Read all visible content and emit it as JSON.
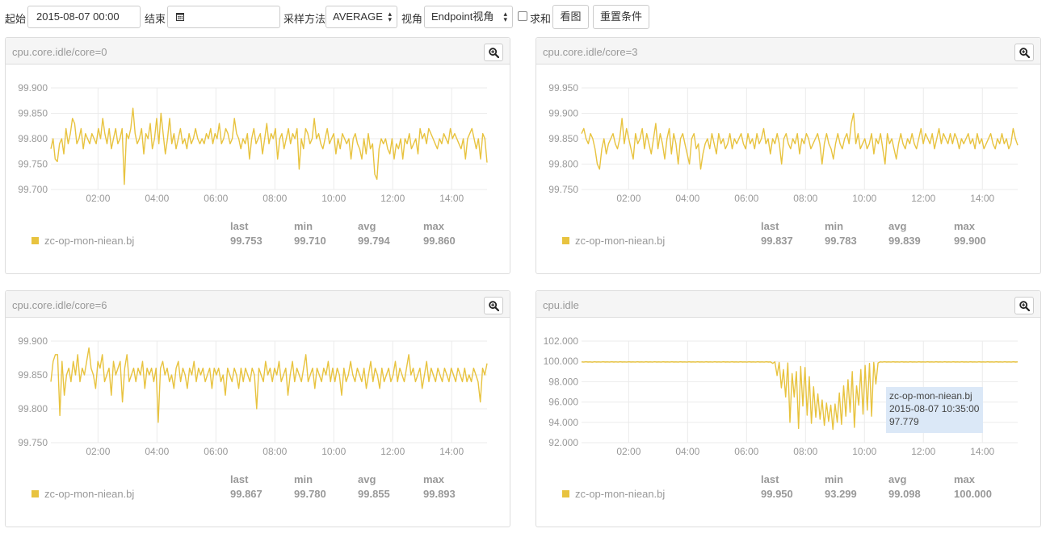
{
  "toolbar": {
    "start_label": "起始",
    "start_value": "2015-08-07 00:00",
    "end_label": "结束",
    "end_value": "",
    "sampling_label": "采样方法",
    "sampling_value": "AVERAGE",
    "view_label": "视角",
    "view_value": "Endpoint视角",
    "sum_label": "求和",
    "sum_checked": false,
    "view_button": "看图",
    "reset_button": "重置条件"
  },
  "stats_headers": [
    "last",
    "min",
    "avg",
    "max"
  ],
  "series_color": "#e8c33f",
  "tooltip": {
    "chart_index": 3,
    "line1": "zc-op-mon-niean.bj",
    "line2": "2015-08-07 10:35:00",
    "line3": "97.779",
    "x_hour": 10.583
  },
  "chart_data": [
    {
      "type": "line",
      "title": "cpu.core.idle/core=0",
      "xlim": [
        0.4,
        15.2
      ],
      "ylim": [
        99.7,
        99.9
      ],
      "yticks": [
        "99.700",
        "99.750",
        "99.800",
        "99.850",
        "99.900"
      ],
      "xticks": [
        "02:00",
        "04:00",
        "06:00",
        "08:00",
        "10:00",
        "12:00",
        "14:00"
      ],
      "grid": true,
      "series": [
        {
          "name": "zc-op-mon-niean.bj",
          "x_start": 0.4,
          "x_end": 15.2,
          "y": [
            99.78,
            99.8,
            99.76,
            99.755,
            99.79,
            99.8,
            99.77,
            99.82,
            99.79,
            99.81,
            99.84,
            99.83,
            99.79,
            99.8,
            99.82,
            99.78,
            99.81,
            99.8,
            99.79,
            99.81,
            99.8,
            99.79,
            99.82,
            99.8,
            99.84,
            99.81,
            99.79,
            99.82,
            99.78,
            99.8,
            99.82,
            99.79,
            99.8,
            99.82,
            99.71,
            99.81,
            99.8,
            99.82,
            99.86,
            99.81,
            99.79,
            99.8,
            99.82,
            99.77,
            99.81,
            99.8,
            99.83,
            99.78,
            99.8,
            99.84,
            99.79,
            99.85,
            99.81,
            99.77,
            99.8,
            99.84,
            99.79,
            99.81,
            99.78,
            99.8,
            99.82,
            99.79,
            99.8,
            99.78,
            99.81,
            99.79,
            99.8,
            99.82,
            99.8,
            99.79,
            99.8,
            99.79,
            99.81,
            99.8,
            99.82,
            99.79,
            99.81,
            99.8,
            99.83,
            99.79,
            99.8,
            99.82,
            99.81,
            99.79,
            99.8,
            99.84,
            99.81,
            99.8,
            99.78,
            99.8,
            99.79,
            99.81,
            99.76,
            99.8,
            99.82,
            99.79,
            99.8,
            99.81,
            99.77,
            99.8,
            99.83,
            99.79,
            99.81,
            99.8,
            99.82,
            99.76,
            99.8,
            99.81,
            99.78,
            99.8,
            99.82,
            99.79,
            99.81,
            99.8,
            99.82,
            99.74,
            99.8,
            99.78,
            99.82,
            99.81,
            99.79,
            99.8,
            99.84,
            99.8,
            99.81,
            99.79,
            99.78,
            99.8,
            99.82,
            99.79,
            99.8,
            99.81,
            99.77,
            99.8,
            99.78,
            99.81,
            99.8,
            99.79,
            99.8,
            99.76,
            99.8,
            99.81,
            99.79,
            99.78,
            99.76,
            99.8,
            99.77,
            99.81,
            99.78,
            99.79,
            99.73,
            99.72,
            99.78,
            99.8,
            99.79,
            99.8,
            99.78,
            99.77,
            99.8,
            99.76,
            99.79,
            99.78,
            99.8,
            99.76,
            99.8,
            99.79,
            99.81,
            99.78,
            99.79,
            99.8,
            99.77,
            99.82,
            99.8,
            99.81,
            99.79,
            99.82,
            99.81,
            99.8,
            99.79,
            99.78,
            99.8,
            99.79,
            99.81,
            99.8,
            99.79,
            99.82,
            99.8,
            99.81,
            99.8,
            99.79,
            99.78,
            99.8,
            99.76,
            99.8,
            99.81,
            99.82,
            99.8,
            99.78,
            99.8,
            99.76,
            99.81,
            99.8,
            99.753
          ]
        }
      ],
      "stats": [
        "99.753",
        "99.710",
        "99.794",
        "99.860"
      ]
    },
    {
      "type": "line",
      "title": "cpu.core.idle/core=3",
      "xlim": [
        0.4,
        15.2
      ],
      "ylim": [
        99.75,
        99.95
      ],
      "yticks": [
        "99.750",
        "99.800",
        "99.850",
        "99.900",
        "99.950"
      ],
      "xticks": [
        "02:00",
        "04:00",
        "06:00",
        "08:00",
        "10:00",
        "12:00",
        "14:00"
      ],
      "grid": true,
      "series": [
        {
          "name": "zc-op-mon-niean.bj",
          "x_start": 0.4,
          "x_end": 15.2,
          "y": [
            99.86,
            99.87,
            99.85,
            99.84,
            99.86,
            99.85,
            99.83,
            99.8,
            99.79,
            99.83,
            99.85,
            99.82,
            99.84,
            99.85,
            99.86,
            99.84,
            99.83,
            99.85,
            99.89,
            99.84,
            99.87,
            99.85,
            99.83,
            99.81,
            99.86,
            99.84,
            99.85,
            99.87,
            99.83,
            99.86,
            99.84,
            99.82,
            99.85,
            99.88,
            99.83,
            99.86,
            99.84,
            99.81,
            99.85,
            99.87,
            99.82,
            99.86,
            99.84,
            99.8,
            99.85,
            99.86,
            99.84,
            99.82,
            99.8,
            99.85,
            99.86,
            99.83,
            99.84,
            99.79,
            99.82,
            99.84,
            99.85,
            99.83,
            99.86,
            99.84,
            99.82,
            99.86,
            99.84,
            99.85,
            99.83,
            99.84,
            99.86,
            99.83,
            99.85,
            99.84,
            99.85,
            99.86,
            99.84,
            99.83,
            99.86,
            99.84,
            99.85,
            99.83,
            99.86,
            99.84,
            99.85,
            99.87,
            99.84,
            99.85,
            99.82,
            99.85,
            99.84,
            99.86,
            99.84,
            99.8,
            99.85,
            99.86,
            99.84,
            99.83,
            99.85,
            99.84,
            99.86,
            99.82,
            99.85,
            99.84,
            99.86,
            99.85,
            99.83,
            99.84,
            99.85,
            99.86,
            99.84,
            99.8,
            99.84,
            99.86,
            99.84,
            99.83,
            99.81,
            99.84,
            99.86,
            99.84,
            99.83,
            99.85,
            99.86,
            99.84,
            99.88,
            99.9,
            99.84,
            99.86,
            99.83,
            99.84,
            99.85,
            99.83,
            99.84,
            99.86,
            99.82,
            99.85,
            99.84,
            99.86,
            99.83,
            99.8,
            99.86,
            99.84,
            99.85,
            99.83,
            99.81,
            99.84,
            99.86,
            99.84,
            99.83,
            99.85,
            99.84,
            99.86,
            99.84,
            99.83,
            99.85,
            99.87,
            99.84,
            99.86,
            99.85,
            99.84,
            99.86,
            99.83,
            99.85,
            99.87,
            99.84,
            99.86,
            99.85,
            99.84,
            99.86,
            99.84,
            99.86,
            99.85,
            99.83,
            99.85,
            99.84,
            99.85,
            99.86,
            99.84,
            99.85,
            99.83,
            99.86,
            99.84,
            99.85,
            99.83,
            99.84,
            99.85,
            99.86,
            99.84,
            99.83,
            99.85,
            99.84,
            99.86,
            99.84,
            99.85,
            99.83,
            99.84,
            99.87,
            99.85,
            99.837
          ]
        }
      ],
      "stats": [
        "99.837",
        "99.783",
        "99.839",
        "99.900"
      ]
    },
    {
      "type": "line",
      "title": "cpu.core.idle/core=6",
      "xlim": [
        0.4,
        15.2
      ],
      "ylim": [
        99.75,
        99.9
      ],
      "yticks": [
        "99.750",
        "99.800",
        "99.850",
        "99.900"
      ],
      "xticks": [
        "02:00",
        "04:00",
        "06:00",
        "08:00",
        "10:00",
        "12:00",
        "14:00"
      ],
      "grid": true,
      "series": [
        {
          "name": "zc-op-mon-niean.bj",
          "x_start": 0.4,
          "x_end": 15.2,
          "y": [
            99.84,
            99.87,
            99.88,
            99.88,
            99.79,
            99.87,
            99.82,
            99.85,
            99.86,
            99.84,
            99.87,
            99.85,
            99.88,
            99.84,
            99.86,
            99.85,
            99.87,
            99.89,
            99.86,
            99.85,
            99.83,
            99.87,
            99.86,
            99.88,
            99.84,
            99.85,
            99.86,
            99.82,
            99.87,
            99.85,
            99.86,
            99.87,
            99.81,
            99.86,
            99.88,
            99.84,
            99.85,
            99.86,
            99.84,
            99.86,
            99.85,
            99.87,
            99.83,
            99.86,
            99.85,
            99.86,
            99.84,
            99.86,
            99.78,
            99.86,
            99.87,
            99.85,
            99.86,
            99.84,
            99.85,
            99.83,
            99.86,
            99.87,
            99.84,
            99.86,
            99.85,
            99.83,
            99.86,
            99.85,
            99.87,
            99.84,
            99.86,
            99.85,
            99.86,
            99.84,
            99.85,
            99.86,
            99.83,
            99.86,
            99.85,
            99.86,
            99.84,
            99.85,
            99.82,
            99.86,
            99.85,
            99.84,
            99.86,
            99.85,
            99.83,
            99.86,
            99.84,
            99.86,
            99.85,
            99.84,
            99.86,
            99.85,
            99.8,
            99.86,
            99.85,
            99.84,
            99.87,
            99.85,
            99.86,
            99.84,
            99.86,
            99.85,
            99.87,
            99.84,
            99.85,
            99.86,
            99.82,
            99.85,
            99.87,
            99.84,
            99.86,
            99.85,
            99.84,
            99.86,
            99.88,
            99.84,
            99.85,
            99.86,
            99.83,
            99.86,
            99.85,
            99.84,
            99.86,
            99.85,
            99.87,
            99.84,
            99.86,
            99.84,
            99.86,
            99.85,
            99.82,
            99.86,
            99.84,
            99.85,
            99.87,
            99.85,
            99.84,
            99.86,
            99.85,
            99.84,
            99.86,
            99.83,
            99.85,
            99.87,
            99.84,
            99.86,
            99.85,
            99.83,
            99.86,
            99.84,
            99.85,
            99.86,
            99.84,
            99.85,
            99.87,
            99.84,
            99.86,
            99.85,
            99.84,
            99.86,
            99.88,
            99.85,
            99.86,
            99.84,
            99.85,
            99.86,
            99.83,
            99.85,
            99.87,
            99.84,
            99.86,
            99.85,
            99.84,
            99.86,
            99.85,
            99.84,
            99.86,
            99.85,
            99.84,
            99.86,
            99.85,
            99.84,
            99.86,
            99.85,
            99.84,
            99.86,
            99.84,
            99.85,
            99.84,
            99.86,
            99.85,
            99.84,
            99.81,
            99.86,
            99.85,
            99.867
          ]
        }
      ],
      "stats": [
        "99.867",
        "99.780",
        "99.855",
        "99.893"
      ]
    },
    {
      "type": "line",
      "title": "cpu.idle",
      "xlim": [
        0.4,
        15.2
      ],
      "ylim": [
        92,
        102
      ],
      "yticks": [
        "92.000",
        "94.000",
        "96.000",
        "98.000",
        "100.000",
        "102.000"
      ],
      "xticks": [
        "02:00",
        "04:00",
        "06:00",
        "08:00",
        "10:00",
        "12:00",
        "14:00"
      ],
      "grid": true,
      "series": [
        {
          "name": "zc-op-mon-niean.bj",
          "x_start": 0.4,
          "x_end": 15.2,
          "y": [
            99.95,
            99.93,
            99.96,
            99.94,
            99.95,
            99.92,
            99.96,
            99.94,
            99.95,
            99.93,
            99.96,
            99.94,
            99.95,
            99.93,
            99.96,
            99.94,
            99.95,
            99.93,
            99.96,
            99.94,
            99.95,
            99.93,
            99.96,
            99.94,
            99.95,
            99.93,
            99.96,
            99.94,
            99.95,
            99.93,
            99.96,
            99.94,
            99.95,
            99.93,
            99.96,
            99.94,
            99.95,
            99.93,
            99.96,
            99.94,
            99.95,
            99.93,
            99.96,
            99.94,
            99.95,
            99.93,
            99.96,
            99.94,
            99.95,
            99.93,
            99.96,
            99.94,
            99.95,
            99.93,
            99.96,
            99.94,
            99.95,
            99.93,
            99.96,
            99.94,
            99.95,
            99.93,
            99.96,
            99.94,
            99.95,
            99.93,
            99.96,
            99.94,
            99.95,
            99.93,
            99.96,
            99.94,
            99.95,
            99.93,
            99.96,
            99.94,
            99.95,
            99.93,
            99.96,
            99.94,
            99.95,
            99.93,
            99.96,
            99.94,
            99.95,
            99.93,
            99.96,
            99.94,
            99.95,
            99.8,
            99.95,
            98.6,
            99.9,
            97.4,
            99.2,
            96.5,
            99.85,
            94.0,
            98.8,
            96.5,
            99.0,
            93.4,
            99.5,
            95.6,
            99.4,
            94.7,
            98.5,
            93.9,
            97.5,
            94.5,
            96.8,
            94.3,
            96.2,
            93.7,
            95.9,
            94.1,
            95.7,
            93.3,
            95.8,
            94.0,
            96.9,
            93.8,
            97.6,
            94.6,
            98.2,
            95.0,
            99.0,
            93.5,
            97.6,
            95.7,
            99.2,
            94.8,
            99.6,
            95.2,
            99.8,
            94.6,
            99.9,
            97.78,
            99.85,
            99.95,
            99.93,
            99.96,
            99.94,
            99.95,
            99.93,
            99.96,
            99.94,
            99.95,
            99.93,
            99.96,
            99.94,
            99.95,
            99.93,
            99.96,
            99.94,
            99.95,
            99.93,
            99.96,
            99.94,
            99.95,
            99.93,
            99.96,
            99.94,
            99.95,
            99.93,
            99.96,
            99.94,
            99.95,
            99.93,
            99.96,
            99.94,
            99.95,
            99.93,
            99.96,
            99.94,
            99.95,
            99.93,
            99.96,
            99.94,
            99.95,
            99.93,
            99.96,
            99.94,
            99.95,
            99.93,
            99.96,
            99.94,
            99.95,
            99.93,
            99.96,
            99.94,
            99.95,
            99.93,
            99.96,
            99.94,
            99.95,
            99.93,
            99.96,
            99.94,
            99.95,
            99.93,
            99.96,
            99.94,
            99.95
          ]
        }
      ],
      "stats": [
        "99.950",
        "93.299",
        "99.098",
        "100.000"
      ]
    }
  ]
}
